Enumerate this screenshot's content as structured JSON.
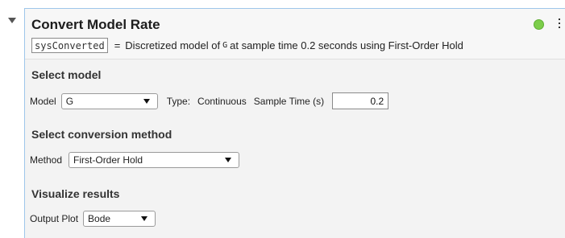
{
  "task": {
    "title": "Convert Model Rate",
    "status_color": "#7ccd4a",
    "collapse_icon": "collapse-triangle-icon",
    "menu_icon": "vertical-ellipsis-icon"
  },
  "summary": {
    "output_variable": "sysConverted",
    "equals": "=",
    "text_before": "Discretized model of",
    "model_name": "G",
    "text_after": "at sample time 0.2 seconds using First-Order Hold"
  },
  "select_model": {
    "heading": "Select model",
    "model_label": "Model",
    "model_value": "G",
    "type_label": "Type:",
    "type_value": "Continuous",
    "sample_time_label": "Sample Time (s)",
    "sample_time_value": "0.2"
  },
  "conversion": {
    "heading": "Select conversion method",
    "method_label": "Method",
    "method_value": "First-Order Hold"
  },
  "visualize": {
    "heading": "Visualize results",
    "plot_label": "Output Plot",
    "plot_value": "Bode"
  }
}
